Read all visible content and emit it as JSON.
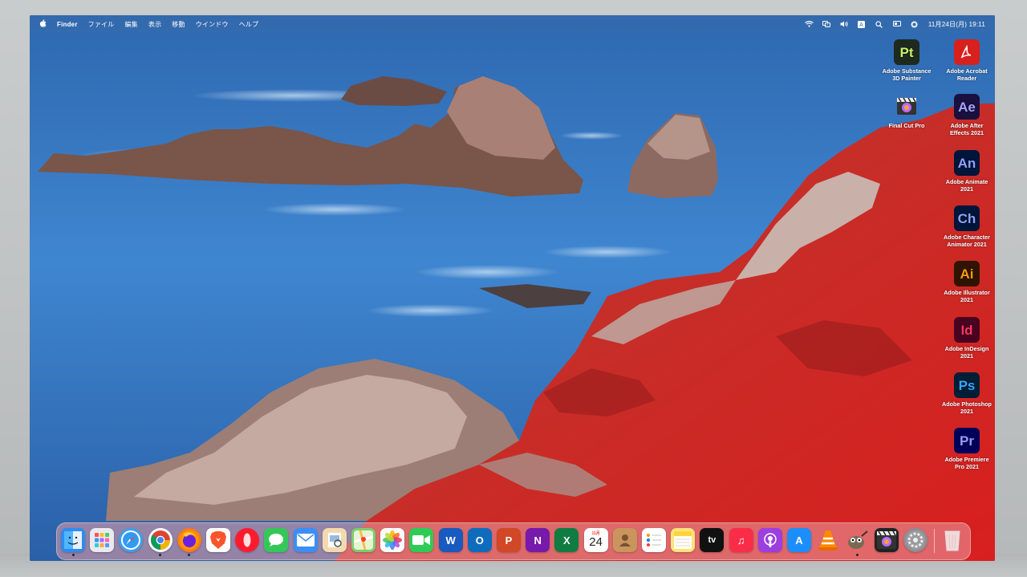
{
  "menubar": {
    "apple": "",
    "app_name": "Finder",
    "items": [
      "ファイル",
      "編集",
      "表示",
      "移動",
      "ウインドウ",
      "ヘルプ"
    ],
    "clock": "11月24日(月)  19:11",
    "status_icons": [
      "wifi-icon",
      "control-center-icon",
      "volume-icon",
      "input-source-icon",
      "spotlight-icon",
      "cast-icon",
      "siri-icon"
    ]
  },
  "desktop_icons": [
    {
      "name": "Adobe Substance 3D Painter",
      "line1": "Adobe Substance",
      "line2": "3D Painter",
      "abbr": "Pt",
      "bg": "#1e2a1e",
      "fg": "#c8f06a",
      "col": 0,
      "row": 0
    },
    {
      "name": "Adobe Acrobat Reader",
      "line1": "Adobe Acrobat",
      "line2": "Reader",
      "abbr": "",
      "bg": "#d8201c",
      "fg": "#ffffff",
      "col": 1,
      "row": 0
    },
    {
      "name": "Final Cut Pro",
      "line1": "Final Cut Pro",
      "line2": "",
      "abbr": "",
      "bg": "#222222",
      "fg": "#ffffff",
      "col": 0,
      "row": 1
    },
    {
      "name": "Adobe After Effects 2021",
      "line1": "Adobe After",
      "line2": "Effects 2021",
      "abbr": "Ae",
      "bg": "#1a1040",
      "fg": "#a7a4ff",
      "col": 1,
      "row": 1
    },
    {
      "name": "Adobe Animate 2021",
      "line1": "Adobe Animate",
      "line2": "2021",
      "abbr": "An",
      "bg": "#00153a",
      "fg": "#8aa3ff",
      "col": 1,
      "row": 2
    },
    {
      "name": "Adobe Character Animator 2021",
      "line1": "Adobe Character",
      "line2": "Animator 2021",
      "abbr": "Ch",
      "bg": "#00153a",
      "fg": "#8aa3ff",
      "col": 1,
      "row": 3
    },
    {
      "name": "Adobe Illustrator 2021",
      "line1": "Adobe Illustrator",
      "line2": "2021",
      "abbr": "Ai",
      "bg": "#2f1500",
      "fg": "#ff9a00",
      "col": 1,
      "row": 4
    },
    {
      "name": "Adobe InDesign 2021",
      "line1": "Adobe InDesign",
      "line2": "2021",
      "abbr": "Id",
      "bg": "#49021f",
      "fg": "#ff3366",
      "col": 1,
      "row": 5
    },
    {
      "name": "Adobe Photoshop 2021",
      "line1": "Adobe Photoshop",
      "line2": "2021",
      "abbr": "Ps",
      "bg": "#001e36",
      "fg": "#31a8ff",
      "col": 1,
      "row": 6
    },
    {
      "name": "Adobe Premiere Pro 2021",
      "line1": "Adobe Premiere",
      "line2": "Pro 2021",
      "abbr": "Pr",
      "bg": "#00005b",
      "fg": "#9999ff",
      "col": 1,
      "row": 7
    }
  ],
  "dock": {
    "apps": [
      {
        "name": "finder-icon",
        "glyph": "",
        "bg": "#2d8cf0",
        "round": false,
        "running": true
      },
      {
        "name": "launchpad-icon",
        "glyph": "",
        "bg": "#e9e9ef",
        "round": false,
        "running": false
      },
      {
        "name": "safari-icon",
        "glyph": "",
        "bg": "#3aa0f0",
        "round": true,
        "running": false
      },
      {
        "name": "chrome-icon",
        "glyph": "",
        "bg": "#ffffff",
        "round": true,
        "running": true
      },
      {
        "name": "firefox-icon",
        "glyph": "",
        "bg": "#ff7a1a",
        "round": true,
        "running": true
      },
      {
        "name": "brave-icon",
        "glyph": "",
        "bg": "#ffffff",
        "round": false,
        "running": false
      },
      {
        "name": "opera-icon",
        "glyph": "",
        "bg": "#ff1b2d",
        "round": true,
        "running": false
      },
      {
        "name": "messages-icon",
        "glyph": "",
        "bg": "#35c759",
        "round": false,
        "running": false
      },
      {
        "name": "mail-icon",
        "glyph": "",
        "bg": "#3b8ef5",
        "round": false,
        "running": false
      },
      {
        "name": "preview-icon",
        "glyph": "",
        "bg": "#f3d9b0",
        "round": false,
        "running": false
      },
      {
        "name": "maps-icon",
        "glyph": "",
        "bg": "#7ccf6a",
        "round": false,
        "running": false
      },
      {
        "name": "photos-icon",
        "glyph": "",
        "bg": "#ffffff",
        "round": false,
        "running": false
      },
      {
        "name": "facetime-icon",
        "glyph": "",
        "bg": "#2ecc55",
        "round": false,
        "running": false
      },
      {
        "name": "word-icon",
        "glyph": "W",
        "bg": "#185abd",
        "round": false,
        "running": false
      },
      {
        "name": "outlook-icon",
        "glyph": "O",
        "bg": "#0f6cbd",
        "round": false,
        "running": false
      },
      {
        "name": "powerpoint-icon",
        "glyph": "P",
        "bg": "#d24726",
        "round": false,
        "running": false
      },
      {
        "name": "onenote-icon",
        "glyph": "N",
        "bg": "#7719aa",
        "round": false,
        "running": false
      },
      {
        "name": "excel-icon",
        "glyph": "X",
        "bg": "#107c41",
        "round": false,
        "running": false
      },
      {
        "name": "calendar-icon",
        "glyph": "24",
        "bg": "#ffffff",
        "round": false,
        "running": false
      },
      {
        "name": "contacts-icon",
        "glyph": "",
        "bg": "#c9955d",
        "round": false,
        "running": false
      },
      {
        "name": "reminders-icon",
        "glyph": "",
        "bg": "#ffffff",
        "round": false,
        "running": false
      },
      {
        "name": "notes-icon",
        "glyph": "",
        "bg": "#ffe27a",
        "round": false,
        "running": false
      },
      {
        "name": "tv-icon",
        "glyph": "tv",
        "bg": "#111111",
        "round": false,
        "running": false
      },
      {
        "name": "music-icon",
        "glyph": "♫",
        "bg": "#fa2d48",
        "round": false,
        "running": false
      },
      {
        "name": "podcasts-icon",
        "glyph": "",
        "bg": "#9b3fe0",
        "round": false,
        "running": false
      },
      {
        "name": "app-store-icon",
        "glyph": "A",
        "bg": "#1c8ef9",
        "round": false,
        "running": false
      },
      {
        "name": "vlc-icon",
        "glyph": "",
        "bg": "transparent",
        "round": false,
        "running": false
      },
      {
        "name": "gimp-icon",
        "glyph": "",
        "bg": "transparent",
        "round": false,
        "running": true
      },
      {
        "name": "final-cut-pro-dock-icon",
        "glyph": "",
        "bg": "#222222",
        "round": false,
        "running": false
      },
      {
        "name": "system-preferences-icon",
        "glyph": "",
        "bg": "#8e8e93",
        "round": true,
        "running": false
      }
    ],
    "trash": {
      "name": "trash-icon"
    },
    "calendar_month": "11月",
    "calendar_day": "24"
  }
}
